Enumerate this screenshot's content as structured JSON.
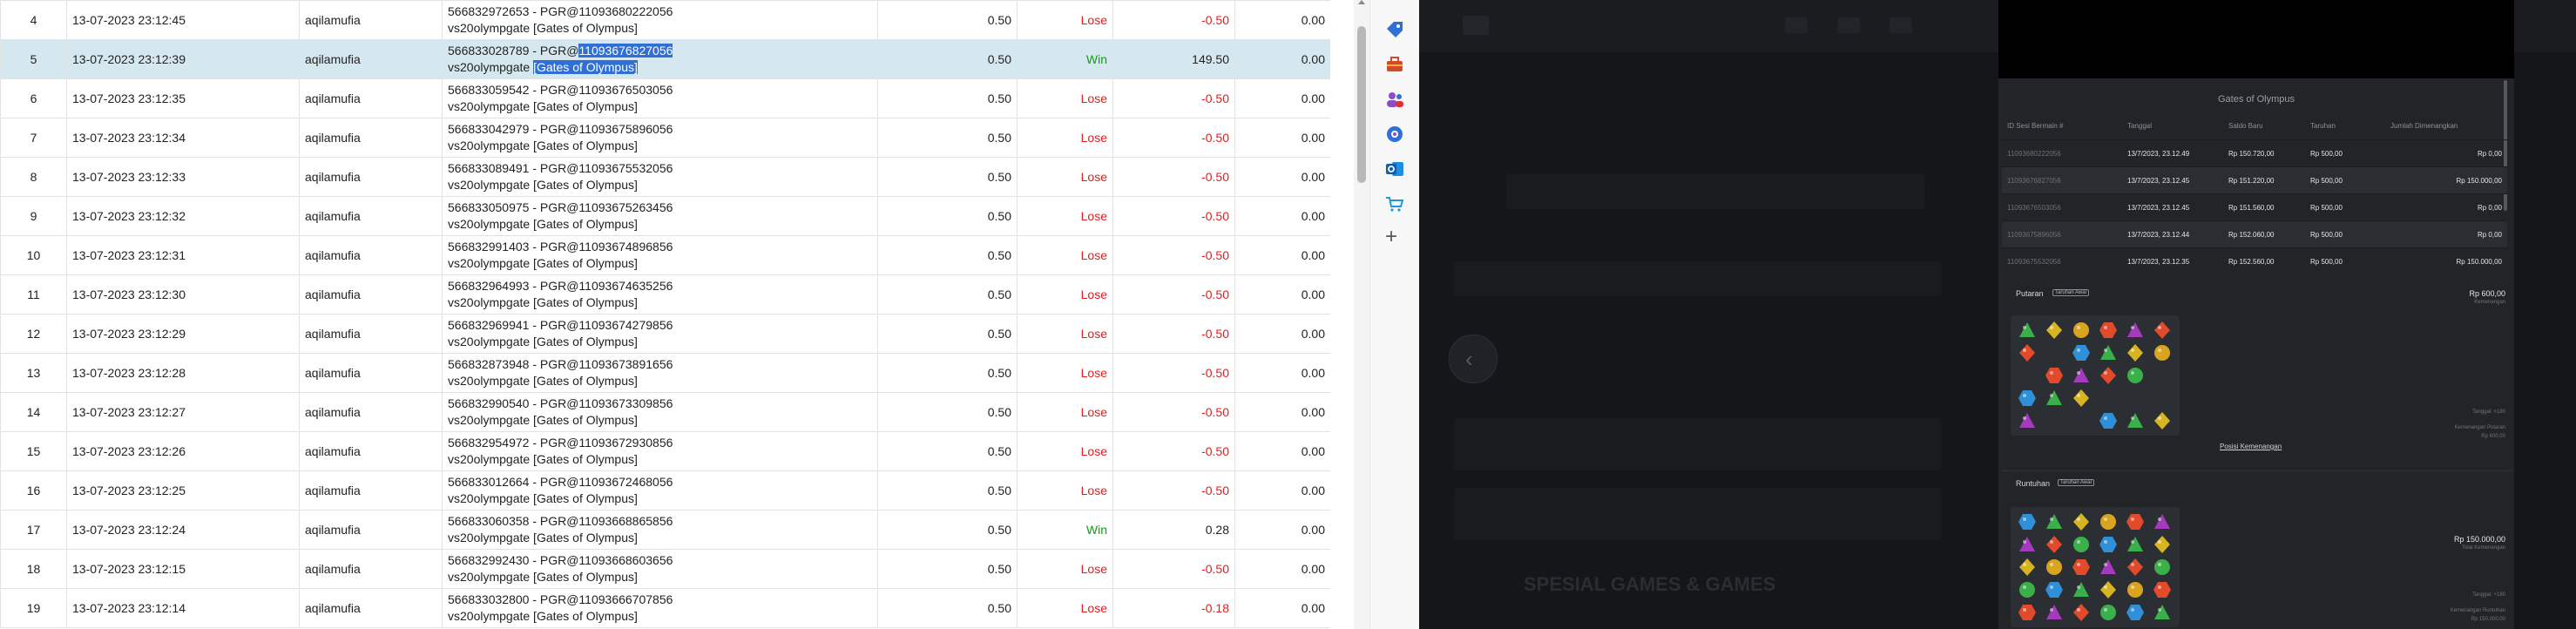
{
  "table": {
    "rows": [
      {
        "no": "4",
        "date": "13-07-2023 23:12:45",
        "user": "aqilamufia",
        "desc_id": "566832972653 - PGR@11093680222056",
        "desc_game": "vs20olympgate [Gates of Olympus]",
        "bet": "0.50",
        "result": "Lose",
        "payout": "-0.50",
        "balance": "0.00",
        "selected": false
      },
      {
        "no": "5",
        "date": "13-07-2023 23:12:39",
        "user": "aqilamufia",
        "desc_id_prefix": "566833028789 - PGR@",
        "desc_id_highlight": "11093676827056",
        "desc_game_prefix": "vs20olympgate ",
        "desc_game_highlight": "[Gates of Olympus]",
        "bet": "0.50",
        "result": "Win",
        "payout": "149.50",
        "balance": "0.00",
        "selected": true
      },
      {
        "no": "6",
        "date": "13-07-2023 23:12:35",
        "user": "aqilamufia",
        "desc_id": "566833059542 - PGR@11093676503056",
        "desc_game": "vs20olympgate [Gates of Olympus]",
        "bet": "0.50",
        "result": "Lose",
        "payout": "-0.50",
        "balance": "0.00",
        "selected": false
      },
      {
        "no": "7",
        "date": "13-07-2023 23:12:34",
        "user": "aqilamufia",
        "desc_id": "566833042979 - PGR@11093675896056",
        "desc_game": "vs20olympgate [Gates of Olympus]",
        "bet": "0.50",
        "result": "Lose",
        "payout": "-0.50",
        "balance": "0.00",
        "selected": false
      },
      {
        "no": "8",
        "date": "13-07-2023 23:12:33",
        "user": "aqilamufia",
        "desc_id": "566833089491 - PGR@11093675532056",
        "desc_game": "vs20olympgate [Gates of Olympus]",
        "bet": "0.50",
        "result": "Lose",
        "payout": "-0.50",
        "balance": "0.00",
        "selected": false
      },
      {
        "no": "9",
        "date": "13-07-2023 23:12:32",
        "user": "aqilamufia",
        "desc_id": "566833050975 - PGR@11093675263456",
        "desc_game": "vs20olympgate [Gates of Olympus]",
        "bet": "0.50",
        "result": "Lose",
        "payout": "-0.50",
        "balance": "0.00",
        "selected": false
      },
      {
        "no": "10",
        "date": "13-07-2023 23:12:31",
        "user": "aqilamufia",
        "desc_id": "566832991403 - PGR@11093674896856",
        "desc_game": "vs20olympgate [Gates of Olympus]",
        "bet": "0.50",
        "result": "Lose",
        "payout": "-0.50",
        "balance": "0.00",
        "selected": false
      },
      {
        "no": "11",
        "date": "13-07-2023 23:12:30",
        "user": "aqilamufia",
        "desc_id": "566832964993 - PGR@11093674635256",
        "desc_game": "vs20olympgate [Gates of Olympus]",
        "bet": "0.50",
        "result": "Lose",
        "payout": "-0.50",
        "balance": "0.00",
        "selected": false
      },
      {
        "no": "12",
        "date": "13-07-2023 23:12:29",
        "user": "aqilamufia",
        "desc_id": "566832969941 - PGR@11093674279856",
        "desc_game": "vs20olympgate [Gates of Olympus]",
        "bet": "0.50",
        "result": "Lose",
        "payout": "-0.50",
        "balance": "0.00",
        "selected": false
      },
      {
        "no": "13",
        "date": "13-07-2023 23:12:28",
        "user": "aqilamufia",
        "desc_id": "566832873948 - PGR@11093673891656",
        "desc_game": "vs20olympgate [Gates of Olympus]",
        "bet": "0.50",
        "result": "Lose",
        "payout": "-0.50",
        "balance": "0.00",
        "selected": false
      },
      {
        "no": "14",
        "date": "13-07-2023 23:12:27",
        "user": "aqilamufia",
        "desc_id": "566832990540 - PGR@11093673309856",
        "desc_game": "vs20olympgate [Gates of Olympus]",
        "bet": "0.50",
        "result": "Lose",
        "payout": "-0.50",
        "balance": "0.00",
        "selected": false
      },
      {
        "no": "15",
        "date": "13-07-2023 23:12:26",
        "user": "aqilamufia",
        "desc_id": "566832954972 - PGR@11093672930856",
        "desc_game": "vs20olympgate [Gates of Olympus]",
        "bet": "0.50",
        "result": "Lose",
        "payout": "-0.50",
        "balance": "0.00",
        "selected": false
      },
      {
        "no": "16",
        "date": "13-07-2023 23:12:25",
        "user": "aqilamufia",
        "desc_id": "566833012664 - PGR@11093672468056",
        "desc_game": "vs20olympgate [Gates of Olympus]",
        "bet": "0.50",
        "result": "Lose",
        "payout": "-0.50",
        "balance": "0.00",
        "selected": false
      },
      {
        "no": "17",
        "date": "13-07-2023 23:12:24",
        "user": "aqilamufia",
        "desc_id": "566833060358 - PGR@11093668865856",
        "desc_game": "vs20olympgate [Gates of Olympus]",
        "bet": "0.50",
        "result": "Win",
        "payout": "0.28",
        "balance": "0.00",
        "selected": false
      },
      {
        "no": "18",
        "date": "13-07-2023 23:12:15",
        "user": "aqilamufia",
        "desc_id": "566832992430 - PGR@11093668603656",
        "desc_game": "vs20olympgate [Gates of Olympus]",
        "bet": "0.50",
        "result": "Lose",
        "payout": "-0.50",
        "balance": "0.00",
        "selected": false
      },
      {
        "no": "19",
        "date": "13-07-2023 23:12:14",
        "user": "aqilamufia",
        "desc_id": "566833032800 - PGR@11093666707856",
        "desc_game": "vs20olympgate [Gates of Olympus]",
        "bet": "0.50",
        "result": "Lose",
        "payout": "-0.18",
        "balance": "0.00",
        "selected": false
      }
    ]
  },
  "sidebar": {
    "icons": [
      "tag-icon",
      "toolbox-icon",
      "people-icon",
      "settings-gear-icon",
      "outlook-icon",
      "shopping-cart-icon",
      "add-icon"
    ],
    "add_label": "+"
  },
  "game_panel": {
    "title": "Gates of Olympus",
    "headers": {
      "id": "ID Sesi Bermain #",
      "date": "Tanggal",
      "balance": "Saldo Baru",
      "bet": "Taruhan",
      "win": "Jumlah Dimenangkan"
    },
    "history": [
      {
        "id": "11093680222056",
        "date": "13/7/2023, 23.12.49",
        "balance": "Rp 150.720,00",
        "bet": "Rp 500,00",
        "win": "Rp 0,00"
      },
      {
        "id": "11093676827056",
        "date": "13/7/2023, 23.12.45",
        "balance": "Rp 151.220,00",
        "bet": "Rp 500,00",
        "win": "Rp 150.000,00"
      },
      {
        "id": "11093676503056",
        "date": "13/7/2023, 23.12.45",
        "balance": "Rp 151.560,00",
        "bet": "Rp 500,00",
        "win": "Rp 0,00"
      },
      {
        "id": "11093675896056",
        "date": "13/7/2023, 23.12.44",
        "balance": "Rp 152.060,00",
        "bet": "Rp 500,00",
        "win": "Rp 0,00"
      },
      {
        "id": "11093675532056",
        "date": "13/7/2023, 23.12.35",
        "balance": "Rp 152.560,00",
        "bet": "Rp 500,00",
        "win": "Rp 150.000,00"
      }
    ],
    "spin": {
      "label": "Putaran",
      "badge": "Taruhan Awal",
      "amount": "Rp 600,00",
      "amount_sub": "Kemenangan",
      "note1": "Tanggal: ×180",
      "note2": "Kemenangan Putaran",
      "note3": "Rp 600,00",
      "link": "Posisi Kemenangan"
    },
    "cascade": {
      "label": "Runtuhan",
      "badge": "Taruhan Awal",
      "amount": "Rp 150.000,00",
      "amount_sub": "Total Kemenangan",
      "note1": "Tanggal: ×180",
      "note2": "Kemenangan Runtuhan",
      "note3": "Rp 150.000,00"
    },
    "gem_colors": [
      "#3bb04a",
      "#e14a2a",
      "#d9a520",
      "#2f8fd8",
      "#a43bbd",
      "#d8b520",
      "#3bb04a",
      "#e14a2a"
    ]
  },
  "background_page": {
    "ghost_text_1": "SPESIAL GAMES & GAMES"
  }
}
